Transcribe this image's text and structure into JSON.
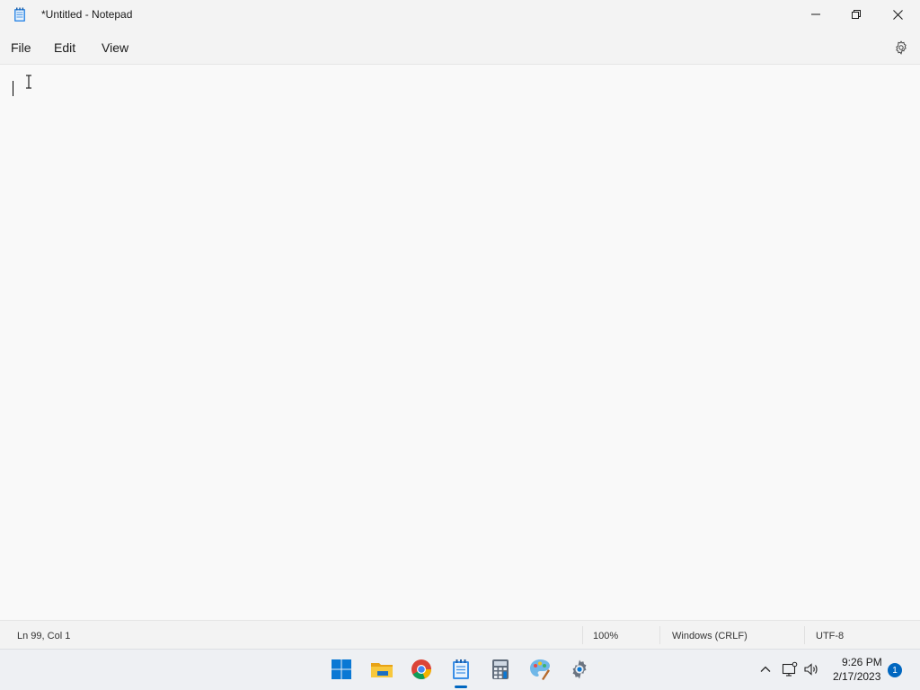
{
  "window": {
    "title": "*Untitled - Notepad",
    "app_icon": "notepad-icon"
  },
  "menubar": {
    "items": [
      {
        "label": "File"
      },
      {
        "label": "Edit"
      },
      {
        "label": "View"
      }
    ],
    "settings_icon": "gear-icon"
  },
  "editor": {
    "text": ""
  },
  "statusbar": {
    "position": "Ln 99, Col 1",
    "zoom": "100%",
    "line_ending": "Windows (CRLF)",
    "encoding": "UTF-8"
  },
  "taskbar": {
    "apps": [
      {
        "name": "start-icon"
      },
      {
        "name": "file-explorer-icon"
      },
      {
        "name": "chrome-icon"
      },
      {
        "name": "notepad-icon",
        "active": true
      },
      {
        "name": "calculator-icon"
      },
      {
        "name": "paint-icon"
      },
      {
        "name": "settings-icon"
      }
    ],
    "clock": {
      "time": "9:26 PM",
      "date": "2/17/2023"
    },
    "notification_count": "1"
  },
  "colors": {
    "accent": "#0067c0",
    "chrome_bg": "#f3f3f3",
    "editor_bg": "#f9f9f9"
  }
}
